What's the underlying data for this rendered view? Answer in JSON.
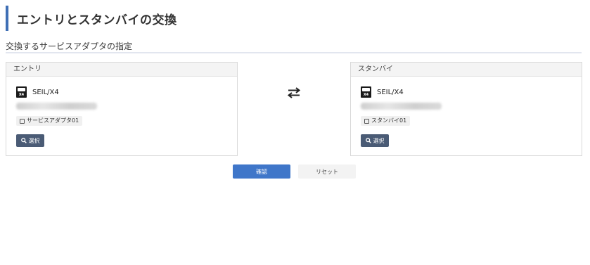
{
  "page": {
    "title": "エントリとスタンバイの交換"
  },
  "section": {
    "title": "交換するサービスアダプタの指定"
  },
  "entry": {
    "header": "エントリ",
    "device_name": "SEIL/X4",
    "device_badge": "X4",
    "adapter_tag": "サービスアダプタ01",
    "select_label": "選択"
  },
  "standby": {
    "header": "スタンバイ",
    "device_name": "SEIL/X4",
    "device_badge": "X4",
    "adapter_tag": "スタンバイ01",
    "select_label": "選択"
  },
  "actions": {
    "confirm_label": "確認",
    "reset_label": "リセット"
  },
  "colors": {
    "accent": "#3f6fb5",
    "primary_button": "#3f76c9",
    "select_button": "#4a5b75"
  },
  "icons": {
    "swap": "swap-arrows-icon",
    "device": "router-device-icon",
    "tag": "tag-icon",
    "search": "search-icon"
  }
}
